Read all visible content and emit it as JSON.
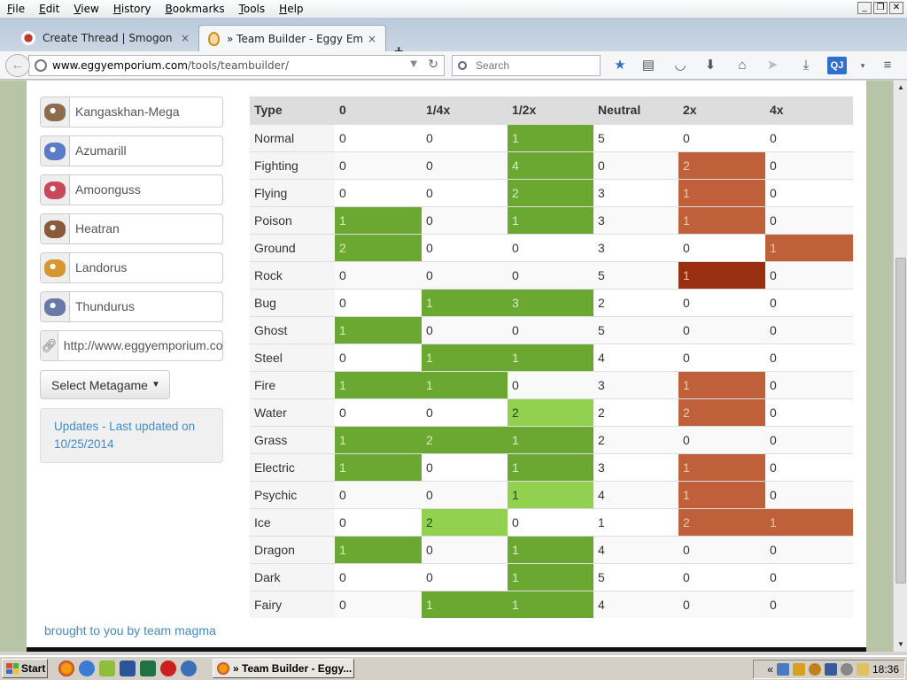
{
  "menubar": {
    "items": [
      "File",
      "Edit",
      "View",
      "History",
      "Bookmarks",
      "Tools",
      "Help"
    ],
    "underline": [
      "F",
      "E",
      "V",
      "H",
      "B",
      "T",
      "H"
    ]
  },
  "tabs": [
    {
      "title": "Create Thread | Smogon Foru...",
      "close": "×"
    },
    {
      "title": "» Team Builder - Eggy Emporium",
      "close": "×"
    }
  ],
  "new_tab": "+",
  "url": {
    "host": "www.eggyemporium.com",
    "path": "/tools/teambuilder/"
  },
  "search": {
    "placeholder": "Search"
  },
  "team": [
    {
      "name": "Kangaskhan-Mega",
      "sprite_color": "#8b6d4c"
    },
    {
      "name": "Azumarill",
      "sprite_color": "#5a7cc8"
    },
    {
      "name": "Amoonguss",
      "sprite_color": "#c84a5a"
    },
    {
      "name": "Heatran",
      "sprite_color": "#8a5a3a"
    },
    {
      "name": "Landorus",
      "sprite_color": "#d8962e"
    },
    {
      "name": "Thundurus",
      "sprite_color": "#6a7aa8"
    }
  ],
  "export_link": "http://www.eggyemporium.com/tools/teambuilder/",
  "metagame_button": "Select Metagame",
  "updates": "Updates - Last updated on 10/25/2014",
  "credits": "brought to you by team magma",
  "colors": {
    "resist": "#6aa832",
    "resist_light": "#92d050",
    "weak": "#c0603a",
    "weak_dark": "#992e10",
    "link": "#428bca"
  },
  "table": {
    "headers": [
      "Type",
      "0",
      "1/4x",
      "1/2x",
      "Neutral",
      "2x",
      "4x"
    ],
    "rows": [
      {
        "type": "Normal",
        "values": [
          "0",
          "0",
          "1",
          "5",
          "0",
          "0"
        ]
      },
      {
        "type": "Fighting",
        "values": [
          "0",
          "0",
          "4",
          "0",
          "2",
          "0"
        ]
      },
      {
        "type": "Flying",
        "values": [
          "0",
          "0",
          "2",
          "3",
          "1",
          "0"
        ]
      },
      {
        "type": "Poison",
        "values": [
          "1",
          "0",
          "1",
          "3",
          "1",
          "0"
        ]
      },
      {
        "type": "Ground",
        "values": [
          "2",
          "0",
          "0",
          "3",
          "0",
          "1"
        ]
      },
      {
        "type": "Rock",
        "values": [
          "0",
          "0",
          "0",
          "5",
          "1",
          "0"
        ]
      },
      {
        "type": "Bug",
        "values": [
          "0",
          "1",
          "3",
          "2",
          "0",
          "0"
        ]
      },
      {
        "type": "Ghost",
        "values": [
          "1",
          "0",
          "0",
          "5",
          "0",
          "0"
        ]
      },
      {
        "type": "Steel",
        "values": [
          "0",
          "1",
          "1",
          "4",
          "0",
          "0"
        ]
      },
      {
        "type": "Fire",
        "values": [
          "1",
          "1",
          "0",
          "3",
          "1",
          "0"
        ]
      },
      {
        "type": "Water",
        "values": [
          "0",
          "0",
          "2",
          "2",
          "2",
          "0"
        ]
      },
      {
        "type": "Grass",
        "values": [
          "1",
          "2",
          "1",
          "2",
          "0",
          "0"
        ]
      },
      {
        "type": "Electric",
        "values": [
          "1",
          "0",
          "1",
          "3",
          "1",
          "0"
        ]
      },
      {
        "type": "Psychic",
        "values": [
          "0",
          "0",
          "1",
          "4",
          "1",
          "0"
        ]
      },
      {
        "type": "Ice",
        "values": [
          "0",
          "2",
          "0",
          "1",
          "2",
          "1"
        ]
      },
      {
        "type": "Dragon",
        "values": [
          "1",
          "0",
          "1",
          "4",
          "0",
          "0"
        ]
      },
      {
        "type": "Dark",
        "values": [
          "0",
          "0",
          "1",
          "5",
          "0",
          "0"
        ]
      },
      {
        "type": "Fairy",
        "values": [
          "0",
          "1",
          "1",
          "4",
          "0",
          "0"
        ]
      }
    ],
    "highlight": [
      [
        "",
        "",
        "g",
        "",
        "",
        ""
      ],
      [
        "",
        "",
        "g",
        "",
        "o",
        ""
      ],
      [
        "",
        "",
        "g",
        "",
        "o",
        ""
      ],
      [
        "g",
        "",
        "g",
        "",
        "o",
        ""
      ],
      [
        "g",
        "",
        "",
        "",
        "",
        "o"
      ],
      [
        "",
        "",
        "",
        "",
        "r",
        ""
      ],
      [
        "",
        "g",
        "g",
        "",
        "",
        ""
      ],
      [
        "g",
        "",
        "",
        "",
        "",
        ""
      ],
      [
        "",
        "g",
        "g",
        "",
        "",
        ""
      ],
      [
        "g",
        "g",
        "",
        "",
        "o",
        ""
      ],
      [
        "",
        "",
        "lg",
        "",
        "o",
        ""
      ],
      [
        "g",
        "g",
        "g",
        "",
        "",
        ""
      ],
      [
        "g",
        "",
        "g",
        "",
        "o",
        ""
      ],
      [
        "",
        "",
        "lg",
        "",
        "o",
        ""
      ],
      [
        "",
        "lg",
        "",
        "",
        "o",
        "o"
      ],
      [
        "g",
        "",
        "g",
        "",
        "",
        ""
      ],
      [
        "",
        "",
        "g",
        "",
        "",
        ""
      ],
      [
        "",
        "g",
        "g",
        "",
        "",
        ""
      ]
    ]
  },
  "taskbar": {
    "start": "Start",
    "task": "» Team Builder - Eggy...",
    "chevron": "«",
    "clock": "18:36"
  }
}
